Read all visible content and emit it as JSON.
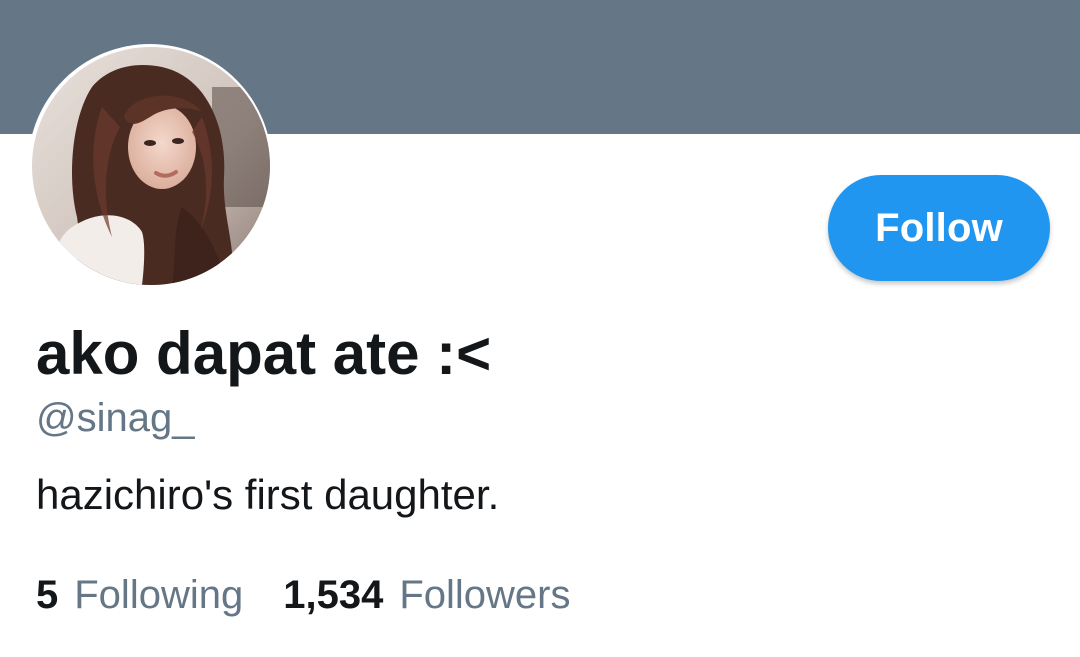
{
  "profile": {
    "banner_color": "#657786",
    "avatar": "profile-photo",
    "display_name": "ako dapat ate :<",
    "handle": "@sinag_",
    "bio": "hazichiro's first daughter."
  },
  "actions": {
    "follow_label": "Follow",
    "follow_color": "#2196f0"
  },
  "stats": {
    "following_count": "5",
    "following_label": "Following",
    "followers_count": "1,534",
    "followers_label": "Followers"
  }
}
